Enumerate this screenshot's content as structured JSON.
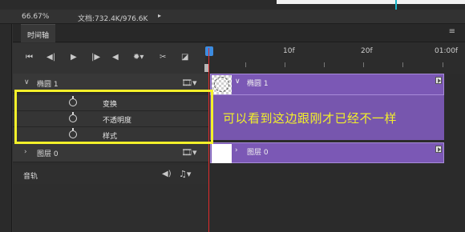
{
  "status": {
    "zoom": "66.67%",
    "doc": "文档:732.4K/976.6K"
  },
  "panel": {
    "tab_label": "时间轴"
  },
  "controls": {
    "icons": [
      "go-first-frame-icon",
      "prev-frame-icon",
      "play-icon",
      "next-frame-icon",
      "audio-icon",
      "settings-icon",
      "split-icon",
      "transition-icon"
    ]
  },
  "ruler": {
    "labels": [
      "10f",
      "20f",
      "01:00f"
    ]
  },
  "layers": [
    {
      "name": "椭圆 1",
      "expanded": true
    },
    {
      "name": "图层 0",
      "expanded": false
    }
  ],
  "properties": [
    "变换",
    "不透明度",
    "样式"
  ],
  "audio": {
    "label": "音轨"
  },
  "clips": [
    {
      "name": "椭圆 1"
    },
    {
      "name": "图层 0"
    }
  ],
  "annotation": {
    "text": "可以看到这边跟刚才已经不一样"
  },
  "colors": {
    "clip_purple": "#7b58b5",
    "highlight_yellow": "#f3f02a",
    "playhead_red": "#e12b2b",
    "playhead_blue": "#3d8ce0"
  }
}
